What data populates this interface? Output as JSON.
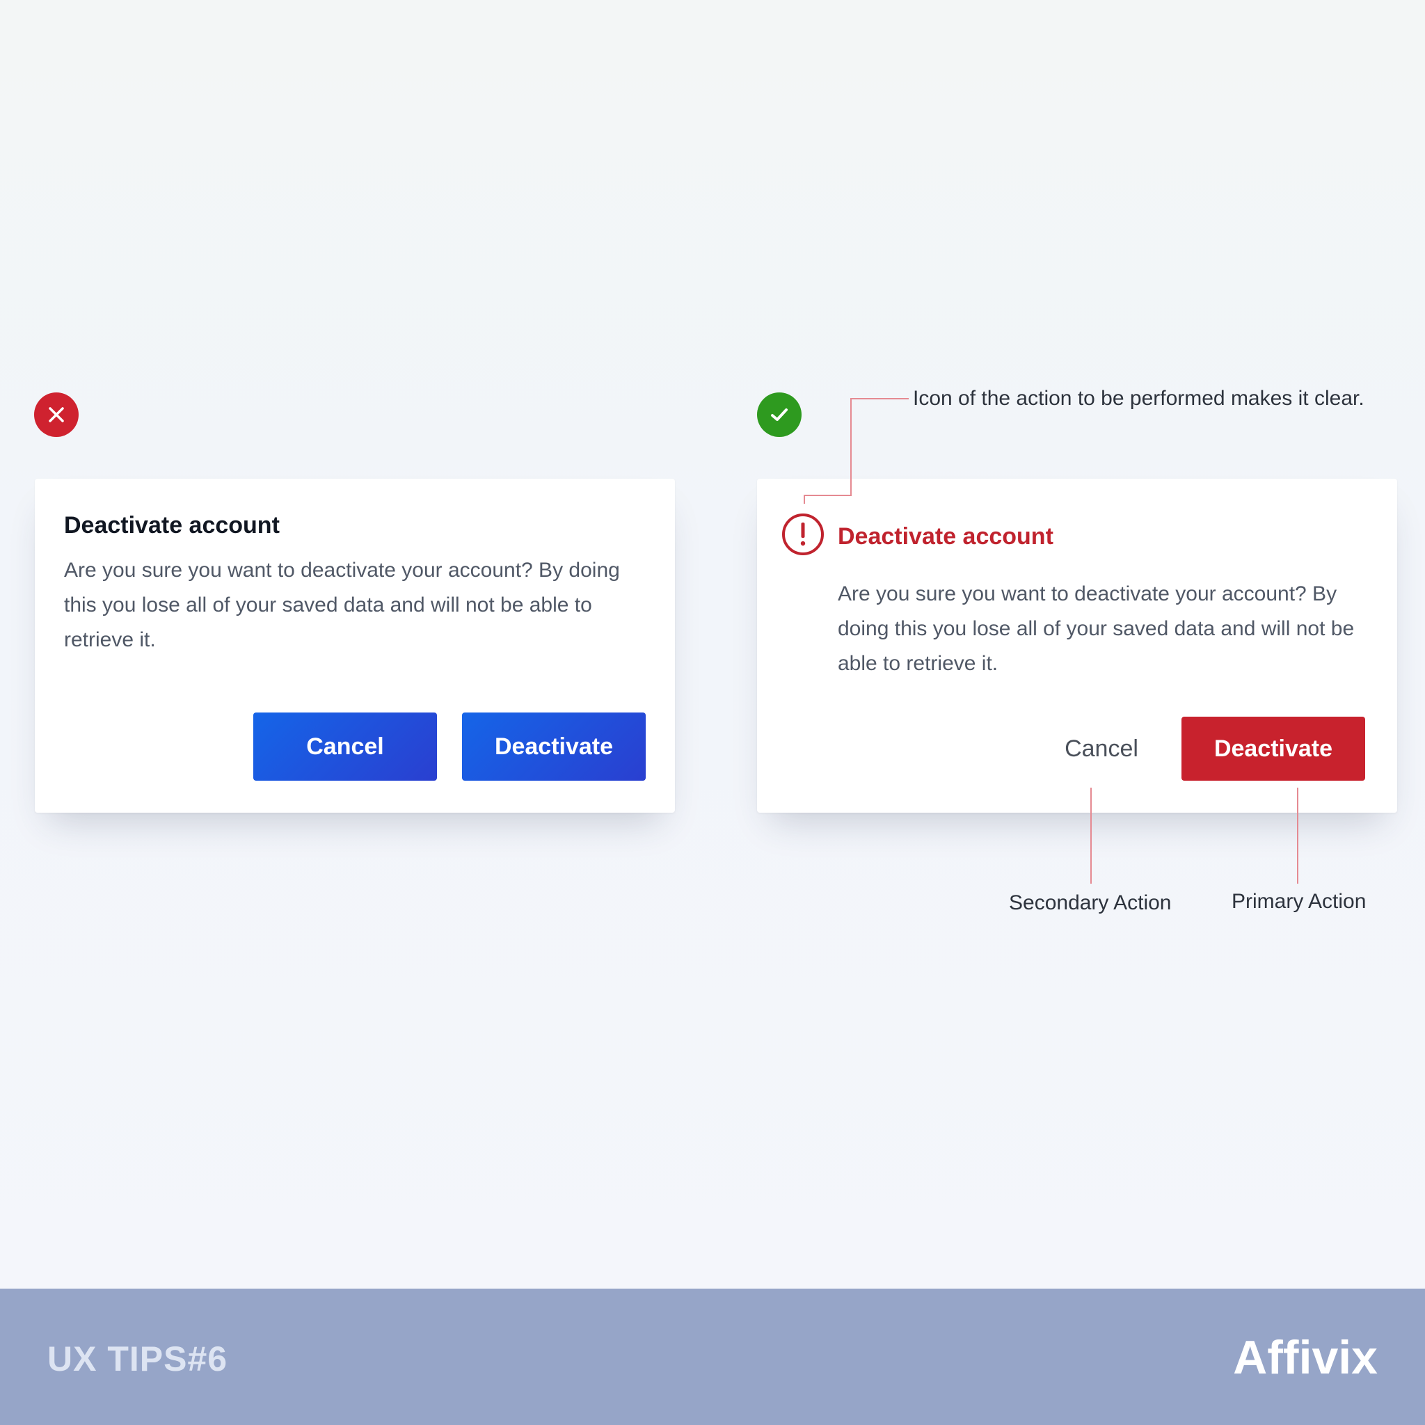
{
  "bad_example": {
    "badge_icon": "close-icon",
    "dialog": {
      "title": "Deactivate account",
      "body": "Are you sure you want to deactivate your account? By doing this you lose all of your saved data and will not be able to retrieve it.",
      "cancel_label": "Cancel",
      "confirm_label": "Deactivate"
    }
  },
  "good_example": {
    "badge_icon": "check-icon",
    "dialog": {
      "icon": "alert-circle-icon",
      "title": "Deactivate account",
      "body": "Are you sure you want to deactivate your account? By doing this you lose all of your saved data and will not be able to retrieve it.",
      "cancel_label": "Cancel",
      "confirm_label": "Deactivate"
    },
    "annotations": {
      "icon_note": "Icon of the action to be performed makes it clear.",
      "secondary_action": "Secondary Action",
      "primary_action": "Primary Action"
    }
  },
  "footer": {
    "tip": "UX TIPS#6",
    "brand": "Affivix"
  },
  "colors": {
    "danger": "#c8222d",
    "success": "#2e9a1f",
    "primary_blue": "#1565e8",
    "footer_bg": "#96a5c8"
  }
}
